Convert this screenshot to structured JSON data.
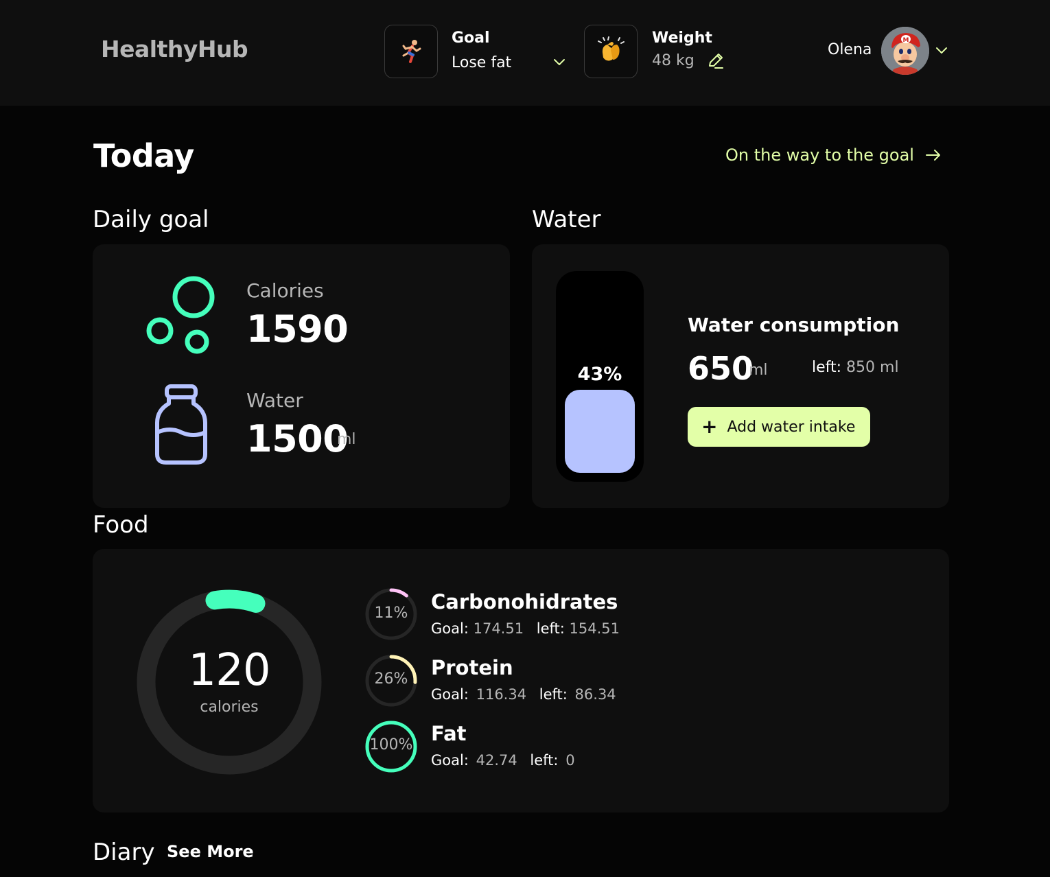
{
  "app": {
    "logo": "HealthyHub"
  },
  "header": {
    "goal": {
      "label": "Goal",
      "value": "Lose fat",
      "icon": "running-person-icon"
    },
    "weight": {
      "label": "Weight",
      "value": "48 kg",
      "icon": "clapping-hands-icon"
    },
    "user": {
      "name": "Olena"
    }
  },
  "page": {
    "title": "Today",
    "goal_link": "On the way to the goal"
  },
  "daily_goal": {
    "section_title": "Daily goal",
    "calories": {
      "label": "Calories",
      "value": "1590"
    },
    "water": {
      "label": "Water",
      "value": "1500",
      "unit": "ml"
    }
  },
  "water": {
    "section_title": "Water",
    "percent_label": "43%",
    "fill_fraction": 0.43,
    "title": "Water consumption",
    "value": "650",
    "unit": "ml",
    "left_label": "left:",
    "left_value": "850 ml",
    "add_button": "Add water intake"
  },
  "food": {
    "section_title": "Food",
    "calories": {
      "value": "120",
      "label": "calories",
      "fraction": 0.08
    },
    "macros": [
      {
        "name": "Carbonohidrates",
        "percent_label": "11%",
        "fraction": 0.11,
        "goal_label": "Goal:",
        "goal": "174.51",
        "left_label": "left:",
        "left": "154.51"
      },
      {
        "name": "Protein",
        "percent_label": "26%",
        "fraction": 0.26,
        "goal_label": "Goal:",
        "goal": "116.34",
        "left_label": "left:",
        "left": "86.34"
      },
      {
        "name": "Fat",
        "percent_label": "100%",
        "fraction": 1.0,
        "goal_label": "Goal:",
        "goal": "42.74",
        "left_label": "left:",
        "left": "0"
      }
    ]
  },
  "diary": {
    "section_title": "Diary",
    "see_more": "See More"
  },
  "colors": {
    "accent_lime": "#e3ffa8",
    "accent_green": "#45ffbc",
    "water_fill": "#b6c3ff",
    "carbs": "#ffc4f7",
    "protein": "#fff3b7",
    "fat": "#45ffbc",
    "muted_text": "#b6b6b6"
  }
}
